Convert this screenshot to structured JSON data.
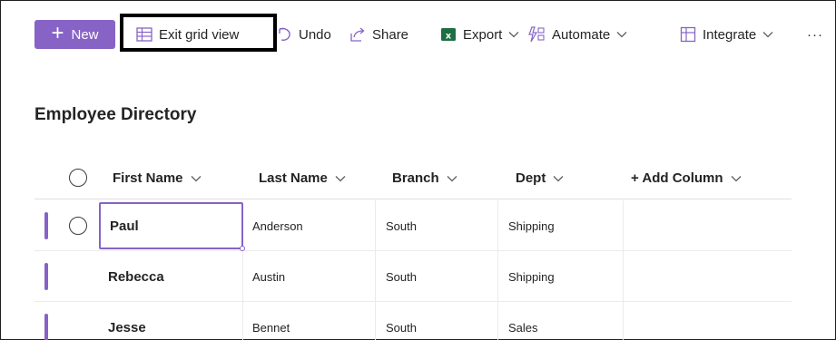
{
  "toolbar": {
    "new_label": "New",
    "exit_grid_label": "Exit grid view",
    "undo_label": "Undo",
    "share_label": "Share",
    "export_label": "Export",
    "automate_label": "Automate",
    "integrate_label": "Integrate",
    "more_label": "···",
    "accent_color": "#8763c6",
    "excel_color": "#1d6f42"
  },
  "list": {
    "title": "Employee Directory",
    "columns": [
      "First Name",
      "Last Name",
      "Branch",
      "Dept",
      "+ Add Column"
    ],
    "rows": [
      {
        "first": "Paul",
        "last": "Anderson",
        "branch": "South",
        "dept": "Shipping",
        "selected": true
      },
      {
        "first": "Rebecca",
        "last": "Austin",
        "branch": "South",
        "dept": "Shipping",
        "selected": false
      },
      {
        "first": "Jesse",
        "last": "Bennet",
        "branch": "South",
        "dept": "Sales",
        "selected": false
      }
    ]
  },
  "icons": [
    "plus-icon",
    "grid-icon",
    "undo-icon",
    "share-icon",
    "excel-icon",
    "automate-icon",
    "integrate-icon",
    "chevron-down-icon",
    "more-icon"
  ]
}
